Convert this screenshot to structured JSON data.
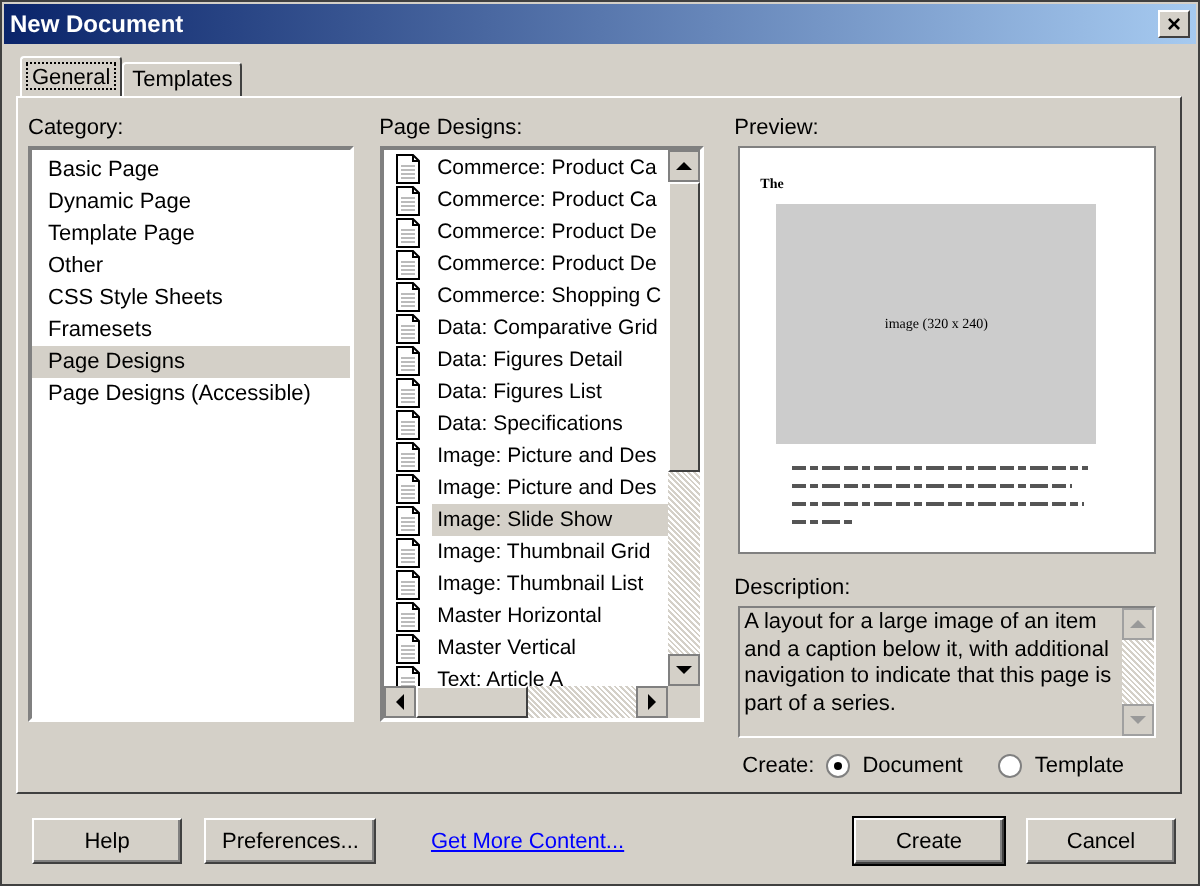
{
  "window": {
    "title": "New Document",
    "close": "×"
  },
  "tabs": [
    {
      "label": "General",
      "selected": true
    },
    {
      "label": "Templates",
      "selected": false
    }
  ],
  "category": {
    "label": "Category:",
    "items": [
      {
        "label": "Basic Page",
        "selected": false
      },
      {
        "label": "Dynamic Page",
        "selected": false
      },
      {
        "label": "Template Page",
        "selected": false
      },
      {
        "label": "Other",
        "selected": false
      },
      {
        "label": "CSS Style Sheets",
        "selected": false
      },
      {
        "label": "Framesets",
        "selected": false
      },
      {
        "label": "Page Designs",
        "selected": true
      },
      {
        "label": "Page Designs (Accessible)",
        "selected": false
      }
    ]
  },
  "page_designs": {
    "label": "Page Designs:",
    "items": [
      {
        "label": "Commerce: Product Ca",
        "selected": false
      },
      {
        "label": "Commerce: Product Ca",
        "selected": false
      },
      {
        "label": "Commerce: Product De",
        "selected": false
      },
      {
        "label": "Commerce: Product De",
        "selected": false
      },
      {
        "label": "Commerce: Shopping C",
        "selected": false
      },
      {
        "label": "Data: Comparative Grid",
        "selected": false
      },
      {
        "label": "Data: Figures Detail",
        "selected": false
      },
      {
        "label": "Data: Figures List",
        "selected": false
      },
      {
        "label": "Data: Specifications",
        "selected": false
      },
      {
        "label": "Image: Picture and Des",
        "selected": false
      },
      {
        "label": "Image: Picture and Des",
        "selected": false
      },
      {
        "label": "Image: Slide Show",
        "selected": true
      },
      {
        "label": "Image: Thumbnail Grid",
        "selected": false
      },
      {
        "label": "Image: Thumbnail List",
        "selected": false
      },
      {
        "label": "Master Horizontal",
        "selected": false
      },
      {
        "label": "Master Vertical",
        "selected": false
      },
      {
        "label": "Text: Article A",
        "selected": false
      }
    ]
  },
  "preview": {
    "label": "Preview:",
    "heading": "The",
    "image_label": "image (320 x 240)"
  },
  "description": {
    "label": "Description:",
    "text": "A layout for a large image of an item and a caption below it, with additional navigation to indicate that this page is part of a series."
  },
  "create": {
    "label": "Create:",
    "options": [
      {
        "label": "Document",
        "selected": true
      },
      {
        "label": "Template",
        "selected": false
      }
    ]
  },
  "buttons": [
    {
      "label": "Help",
      "kind": "button",
      "default": false
    },
    {
      "label": "Preferences...",
      "kind": "button",
      "default": false
    },
    {
      "label": "Get More Content...",
      "kind": "link",
      "default": false
    },
    {
      "label": "Create",
      "kind": "button",
      "default": true
    },
    {
      "label": "Cancel",
      "kind": "button",
      "default": false
    }
  ]
}
